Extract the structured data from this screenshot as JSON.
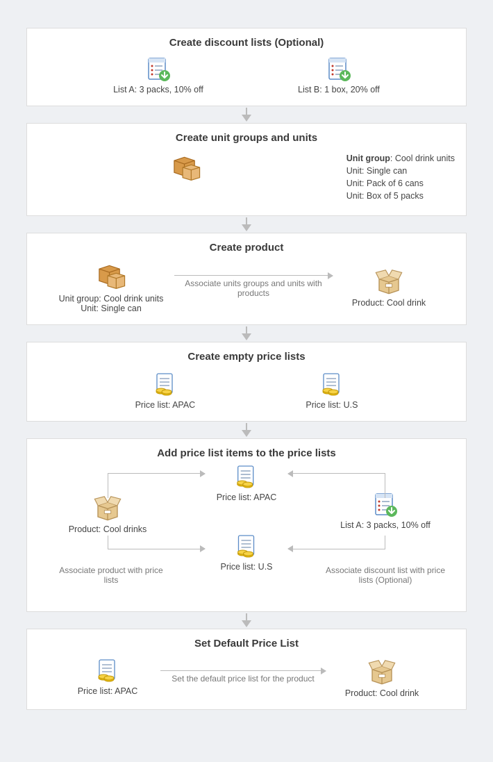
{
  "step1": {
    "title": "Create discount lists (Optional)",
    "listA": "List A: 3 packs, 10% off",
    "listB": "List B: 1 box, 20% off"
  },
  "step2": {
    "title": "Create unit groups and units",
    "group_label": "Unit group",
    "group_value": ": Cool drink units",
    "unit1": "Unit: Single can",
    "unit2": "Unit: Pack of 6 cans",
    "unit3": "Unit: Box of 5 packs"
  },
  "step3": {
    "title": "Create product",
    "left1": "Unit group: Cool drink units",
    "left2": "Unit: Single can",
    "mid": "Associate units groups and units with products",
    "right": "Product: Cool drink"
  },
  "step4": {
    "title": "Create empty price lists",
    "left": "Price list: APAC",
    "right": "Price list: U.S"
  },
  "step5": {
    "title": "Add price list items to the price lists",
    "product": "Product: Cool drinks",
    "list": "List A: 3 packs, 10% off",
    "apac": "Price list: APAC",
    "us": "Price list: U.S",
    "assoc_prod": "Associate product with price lists",
    "assoc_disc": "Associate discount list with price lists (Optional)"
  },
  "step6": {
    "title": "Set Default Price List",
    "left": "Price list: APAC",
    "mid": "Set the default price list for the product",
    "right": "Product: Cool drink"
  }
}
